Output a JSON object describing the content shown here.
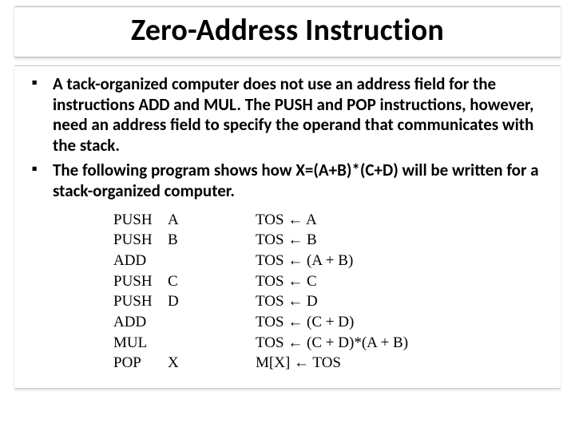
{
  "title": "Zero-Address Instruction",
  "bullets": [
    "A tack-organized computer does not use an address field for the instructions ADD and MUL. The PUSH and POP instructions, however, need an address field to specify the operand that communicates with the stack.",
    "The following program shows how  X=(A+B)*(C+D) will be written for a stack-organized computer."
  ],
  "program": [
    {
      "instr": "PUSH",
      "arg": "A",
      "effect": "TOS ← A"
    },
    {
      "instr": "PUSH",
      "arg": "B",
      "effect": "TOS ← B"
    },
    {
      "instr": "ADD",
      "arg": "",
      "effect": " TOS ← (A + B)"
    },
    {
      "instr": "PUSH",
      "arg": "C",
      "effect": "TOS ← C"
    },
    {
      "instr": "PUSH",
      "arg": "D",
      "effect": "TOS ← D"
    },
    {
      "instr": "ADD",
      "arg": "",
      "effect": "TOS ← (C + D)"
    },
    {
      "instr": "MUL",
      "arg": "",
      "effect": "TOS ← (C + D)*(A + B)"
    },
    {
      "instr": "POP",
      "arg": "X",
      "effect": "M[X] ← TOS"
    }
  ]
}
